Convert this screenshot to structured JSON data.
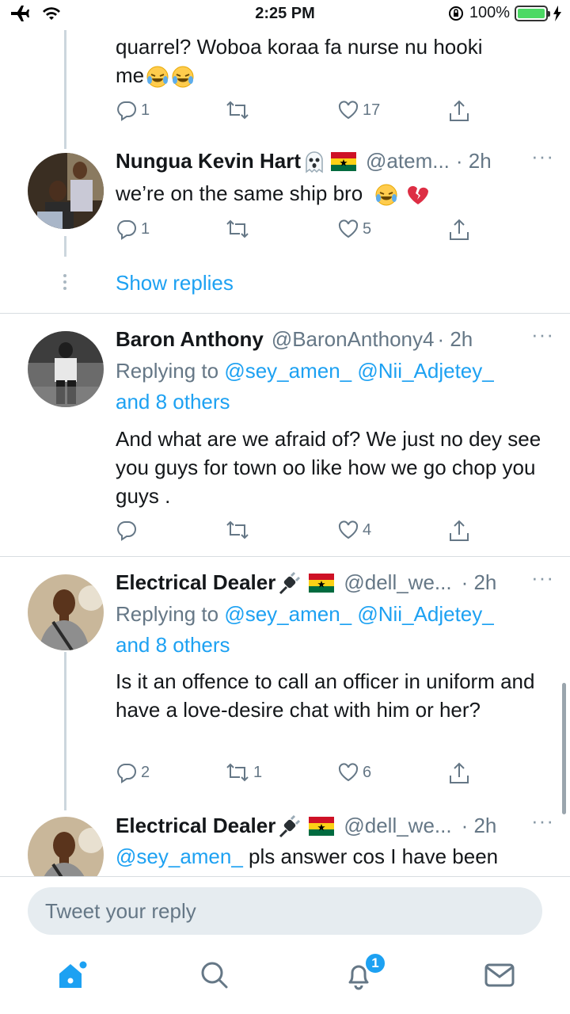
{
  "status_bar": {
    "time": "2:25 PM",
    "battery": "100%"
  },
  "tweets": [
    {
      "text_line1": "quarrel? Woboa koraa fa nurse nu hooki",
      "text_line2": "me",
      "replies": "1",
      "retweets": "",
      "likes": "17"
    },
    {
      "name": "Nungua Kevin Hart",
      "handle": "@atem...",
      "time": "· 2h",
      "text": "we’re on the same ship bro",
      "replies": "1",
      "retweets": "",
      "likes": "5"
    },
    {
      "name": "Baron Anthony",
      "handle": "@BaronAnthony4",
      "time": "· 2h",
      "replying_prefix": "Replying to ",
      "replying_mentions": "@sey_amen_ @Nii_Adjetey_",
      "replying_others": "and 8 others",
      "text": "And what are we afraid of? We just no dey see you guys for town oo like how we go chop you guys .",
      "replies": "",
      "retweets": "",
      "likes": "4"
    },
    {
      "name": "Electrical Dealer",
      "handle": "@dell_we...",
      "time": "· 2h",
      "replying_prefix": "Replying to ",
      "replying_mentions": "@sey_amen_ @Nii_Adjetey_",
      "replying_others": "and 8 others",
      "text": "Is it an offence to call an officer in uniform and have a love-desire chat with him or her?",
      "replies": "2",
      "retweets": "1",
      "likes": "6"
    },
    {
      "name": "Electrical Dealer",
      "handle": "@dell_we...",
      "time": "· 2h",
      "mention": "@sey_amen_",
      "text": " pls answer cos I have been"
    }
  ],
  "show_replies": "Show replies",
  "more_glyph": "···",
  "reply_bar": {
    "placeholder": "Tweet your reply"
  },
  "nav": {
    "notifications_badge": "1"
  },
  "colors": {
    "accent": "#1da1f2",
    "secondary_text": "#657786",
    "thread_line": "#ccd6dd"
  }
}
